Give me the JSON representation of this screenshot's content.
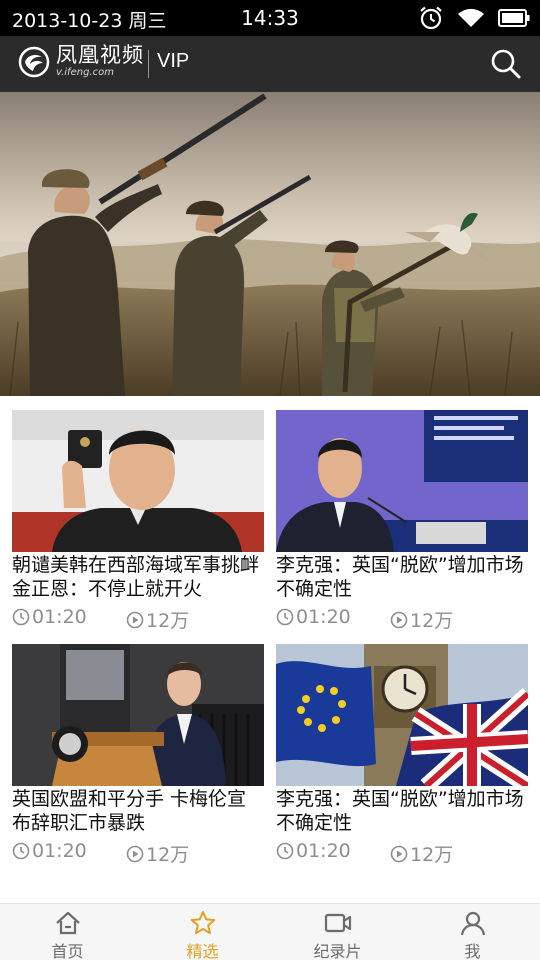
{
  "status_bar": {
    "date": "2013-10-23 周三",
    "time": "14:33",
    "icons": [
      "alarm-clock-icon",
      "wifi-icon",
      "battery-icon"
    ]
  },
  "header": {
    "logo_name": "凤凰视频",
    "logo_url": "v.ifeng.com",
    "vip_label": "VIP",
    "search_icon": "search-icon"
  },
  "hero": {
    "image": "three hunters with shotguns in a misty marsh"
  },
  "videos": [
    {
      "title": "朝谴美韩在西部海域军事挑衅 金正恩：不停止就开火",
      "duration": "01:20",
      "views": "12万"
    },
    {
      "title": "李克强：英国“脱欧”增加市场不确定性",
      "duration": "01:20",
      "views": "12万"
    },
    {
      "title": "英国欧盟和平分手 卡梅伦宣布辞职汇市暴跌",
      "duration": "01:20",
      "views": "12万"
    },
    {
      "title": "李克强：英国“脱欧”增加市场不确定性",
      "duration": "01:20",
      "views": "12万"
    }
  ],
  "bottom_nav": [
    {
      "label": "首页",
      "icon": "home-icon",
      "active": false
    },
    {
      "label": "精选",
      "icon": "star-icon",
      "active": true
    },
    {
      "label": "纪录片",
      "icon": "video-camera-icon",
      "active": false
    },
    {
      "label": "我",
      "icon": "user-icon",
      "active": false
    }
  ],
  "colors": {
    "header_bg": "#2b2b2b",
    "active_tab": "#e2a020",
    "meta_text": "#8e8e8e"
  }
}
